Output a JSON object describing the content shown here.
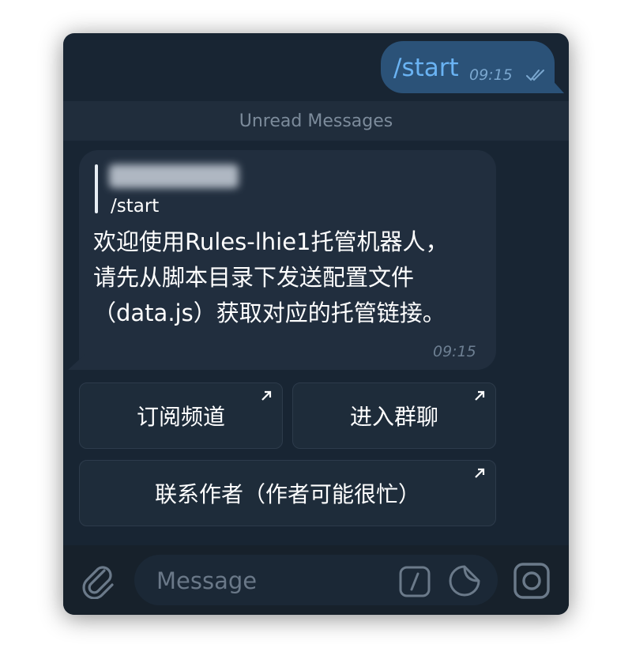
{
  "outgoing": {
    "text": "/start",
    "time": "09:15",
    "status_icon": "double-check-icon"
  },
  "unread_label": "Unread Messages",
  "incoming": {
    "reply_to_text": "/start",
    "text": "欢迎使用Rules-lhie1托管机器人，请先从脚本目录下发送配置文件（data.js）获取对应的托管链接。",
    "time": "09:15"
  },
  "keyboard": [
    {
      "label": "订阅频道",
      "icon": "external-arrow-icon"
    },
    {
      "label": "进入群聊",
      "icon": "external-arrow-icon"
    },
    {
      "label": "联系作者（作者可能很忙）",
      "icon": "external-arrow-icon"
    }
  ],
  "input": {
    "placeholder": "Message"
  },
  "icons": [
    "paperclip-icon",
    "slash-command-icon",
    "sticker-icon",
    "camera-icon"
  ],
  "colors": {
    "background": "#182533",
    "outgoing_bubble": "#2b5278",
    "incoming_bubble": "#212e3e",
    "accent": "#6ab3f3"
  }
}
